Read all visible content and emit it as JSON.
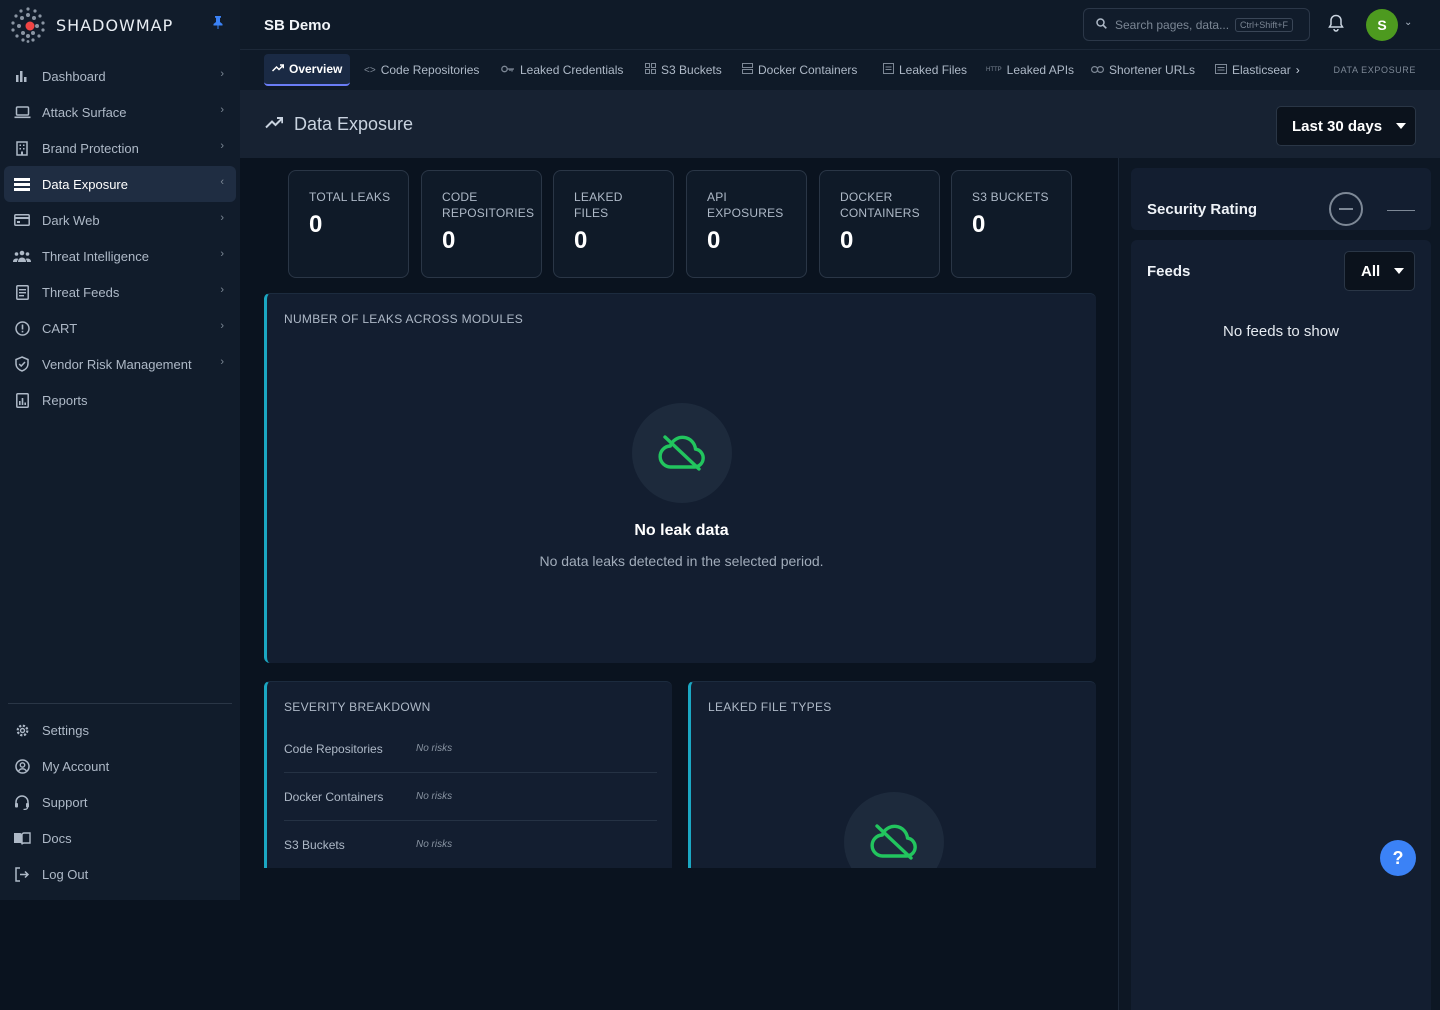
{
  "brand": {
    "name": "SHADOWMAP"
  },
  "sidebar": {
    "items": [
      {
        "label": "Dashboard",
        "icon": "bar-chart-icon"
      },
      {
        "label": "Attack Surface",
        "icon": "laptop-icon"
      },
      {
        "label": "Brand Protection",
        "icon": "building-icon"
      },
      {
        "label": "Data Exposure",
        "icon": "database-icon"
      },
      {
        "label": "Dark Web",
        "icon": "id-card-icon"
      },
      {
        "label": "Threat Intelligence",
        "icon": "users-icon"
      },
      {
        "label": "Threat Feeds",
        "icon": "document-icon"
      },
      {
        "label": "CART",
        "icon": "info-circle-icon"
      },
      {
        "label": "Vendor Risk Management",
        "icon": "shield-check-icon"
      },
      {
        "label": "Reports",
        "icon": "report-icon"
      }
    ],
    "bottom": [
      {
        "label": "Settings",
        "icon": "gear-icon"
      },
      {
        "label": "My Account",
        "icon": "user-circle-icon"
      },
      {
        "label": "Support",
        "icon": "headset-icon"
      },
      {
        "label": "Docs",
        "icon": "book-icon"
      },
      {
        "label": "Log Out",
        "icon": "logout-icon"
      }
    ]
  },
  "topbar": {
    "org": "SB Demo",
    "search_placeholder": "Search pages, data...",
    "shortcut": "Ctrl+Shift+F",
    "avatar_initial": "S"
  },
  "tabs": {
    "items": [
      {
        "label": "Overview",
        "icon": "trend-icon"
      },
      {
        "label": "Code Repositories",
        "icon": "code-icon"
      },
      {
        "label": "Leaked Credentials",
        "icon": "key-icon"
      },
      {
        "label": "S3 Buckets",
        "icon": "grid-icon"
      },
      {
        "label": "Docker Containers",
        "icon": "server-icon"
      },
      {
        "label": "Leaked Files",
        "icon": "file-icon"
      },
      {
        "label": "Leaked APIs",
        "icon": "http-icon"
      },
      {
        "label": "Shortener URLs",
        "icon": "link-icon"
      },
      {
        "label": "Elasticsear",
        "icon": "list-icon"
      }
    ],
    "section_label": "DATA EXPOSURE"
  },
  "header": {
    "title": "Data Exposure",
    "range": "Last 30 days"
  },
  "stats": [
    {
      "label": "TOTAL LEAKS",
      "value": "0"
    },
    {
      "label": "CODE REPOSITORIES",
      "value": "0"
    },
    {
      "label": "LEAKED FILES",
      "value": "0"
    },
    {
      "label": "API EXPOSURES",
      "value": "0"
    },
    {
      "label": "DOCKER CONTAINERS",
      "value": "0"
    },
    {
      "label": "S3 BUCKETS",
      "value": "0"
    }
  ],
  "leaks_panel": {
    "title": "NUMBER OF LEAKS ACROSS MODULES",
    "empty_title": "No leak data",
    "empty_subtitle": "No data leaks detected in the selected period."
  },
  "severity": {
    "title": "SEVERITY BREAKDOWN",
    "rows": [
      {
        "name": "Code Repositories",
        "value": "No risks"
      },
      {
        "name": "Docker Containers",
        "value": "No risks"
      },
      {
        "name": "S3 Buckets",
        "value": "No risks"
      }
    ]
  },
  "file_types": {
    "title": "LEAKED FILE TYPES"
  },
  "right": {
    "rating_title": "Security Rating",
    "feeds_title": "Feeds",
    "feeds_filter": "All",
    "feeds_empty": "No feeds to show"
  },
  "help": {
    "label": "?"
  },
  "colors": {
    "accent_teal": "#1ba7c2",
    "accent_green": "#22c55e",
    "accent_blue": "#3b82f6",
    "avatar_green": "#4d9a1f"
  }
}
